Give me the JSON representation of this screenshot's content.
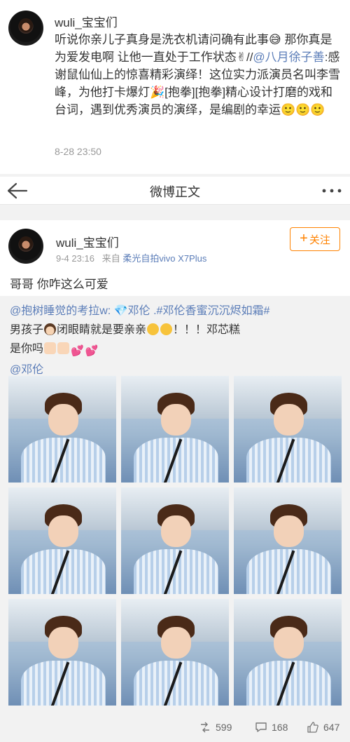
{
  "top_post": {
    "username": "wuli_宝宝们",
    "text_before": "听说你亲儿子真身是洗衣机请问确有此事😅 那你真是为爱发电啊 让他一直处于工作状态✌//",
    "mention": "@八月徐子善",
    "text_after": ":感谢鼠仙仙上的惊喜精彩演绎！这位实力派演员名叫李雪峰，为他打卡爆灯🎉[抱拳][抱拳]精心设计打磨的戏和台词，遇到优秀演员的演绎，是编剧的幸运🙂🙂🙂",
    "time": "8-28 23:50"
  },
  "navbar": {
    "title": "微博正文"
  },
  "post": {
    "username": "wuli_宝宝们",
    "time": "9-4 23:16",
    "source_prefix": "来自",
    "source": "柔光自拍vivo X7Plus",
    "follow_label": "关注",
    "text": "哥哥  你咋这么可爱"
  },
  "repost": {
    "author": "@抱树睡觉的考拉w:",
    "mention1": "💎邓伦",
    "topic": ".#邓伦香蜜沉沉烬如霜#",
    "line2_a": "男孩子",
    "line2_b": "闭眼睛就是要亲亲",
    "line2_c": "！！！邓芯糕",
    "line3": "是你吗",
    "mention2": "@邓伦",
    "photos": [
      "photo-1",
      "photo-2",
      "photo-3",
      "photo-4",
      "photo-5",
      "photo-6",
      "photo-7",
      "photo-8",
      "photo-9"
    ]
  },
  "actions": {
    "repost_count": "599",
    "comment_count": "168",
    "like_count": "647"
  },
  "colors": {
    "link": "#5b7db8",
    "follow": "#ff8200",
    "background_gray": "#f2f2f2"
  },
  "icons": [
    "back-arrow-icon",
    "more-icon",
    "plus-icon",
    "repost-icon",
    "comment-icon",
    "like-icon"
  ]
}
